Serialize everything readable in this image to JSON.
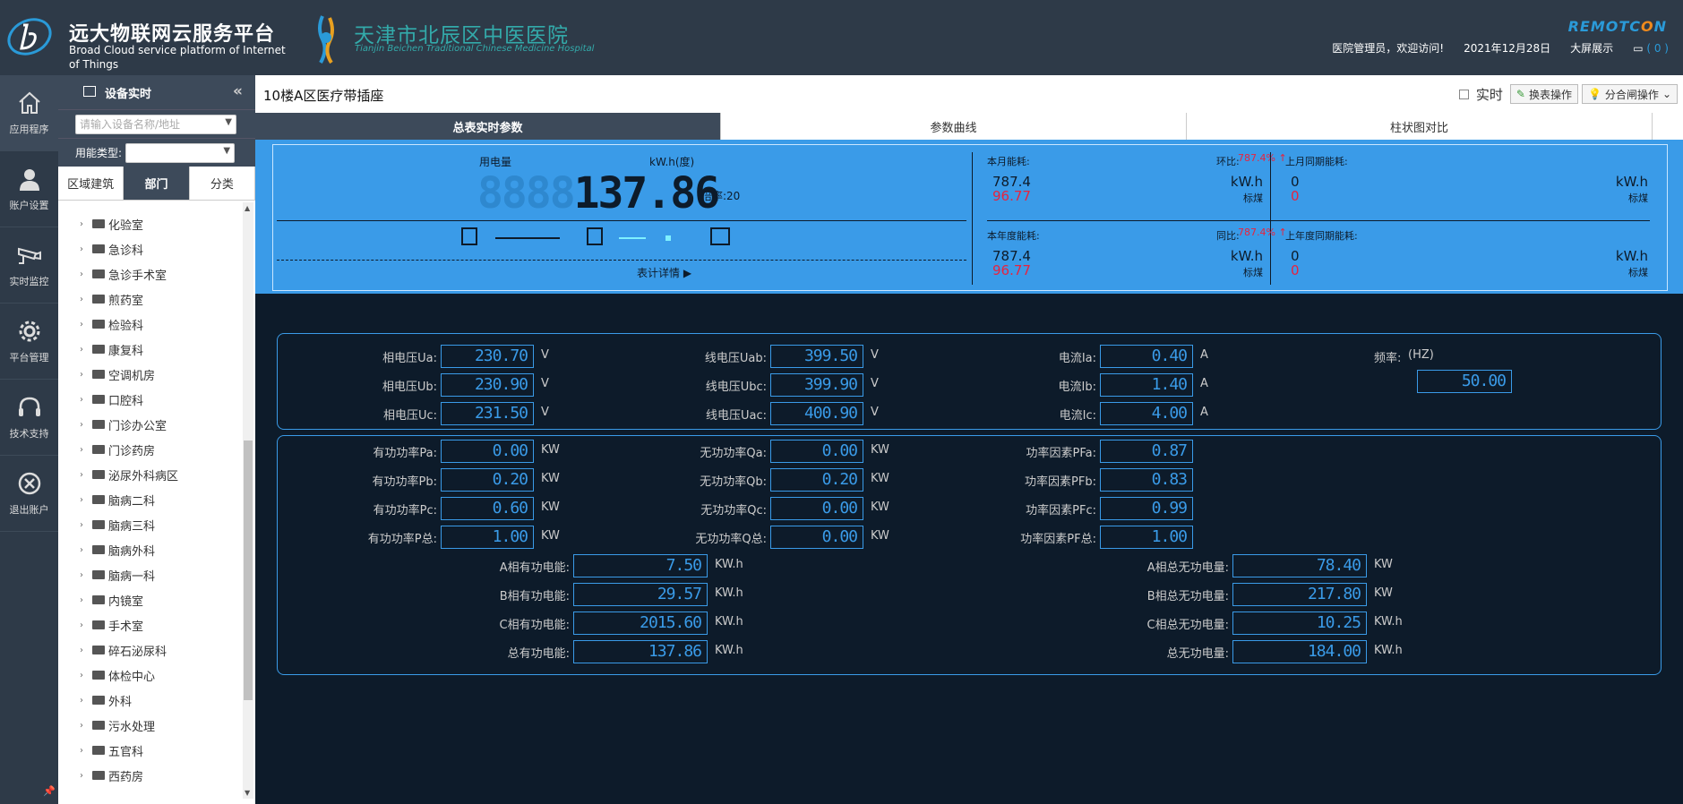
{
  "header": {
    "brand_title": "远大物联网云服务平台",
    "brand_subtitle": "Broad Cloud service platform of Internet of Things",
    "hospital_name": "天津市北辰区中医医院",
    "hospital_en": "Tianjin Beichen Traditional Chinese Medicine Hospital",
    "vendor_logo_prefix": "REMOTC",
    "vendor_logo_mid": "O",
    "vendor_logo_suffix": "N",
    "welcome": "医院管理员，欢迎访问!",
    "date": "2021年12月28日",
    "bigscreen": "大屏展示",
    "msg_count": "( 0 )"
  },
  "leftnav": [
    {
      "label": "应用程序",
      "icon": "home-icon"
    },
    {
      "label": "账户设置",
      "icon": "user-icon"
    },
    {
      "label": "实时监控",
      "icon": "camera-icon"
    },
    {
      "label": "平台管理",
      "icon": "gear-icon"
    },
    {
      "label": "技术支持",
      "icon": "headset-icon"
    },
    {
      "label": "退出账户",
      "icon": "close-circle-icon"
    }
  ],
  "tree": {
    "title": "设备实时",
    "search_placeholder": "请输入设备名称/地址",
    "type_label": "用能类型:",
    "tabs": [
      "区域建筑",
      "部门",
      "分类"
    ],
    "items": [
      "化验室",
      "急诊科",
      "急诊手术室",
      "煎药室",
      "检验科",
      "康复科",
      "空调机房",
      "口腔科",
      "门诊办公室",
      "门诊药房",
      "泌尿外科病区",
      "脑病二科",
      "脑病三科",
      "脑病外科",
      "脑病一科",
      "内镜室",
      "手术室",
      "碎石泌尿科",
      "体检中心",
      "外科",
      "污水处理",
      "五官科",
      "西药房"
    ]
  },
  "main": {
    "title": "10楼A区医疗带插座",
    "realtime_label": "实时",
    "switch_btn": "换表操作",
    "switch_op_btn": "分合闸操作",
    "tabs": [
      "总表实时参数",
      "参数曲线",
      "柱状图对比"
    ]
  },
  "summary": {
    "elec_label": "用电量",
    "elec_unit": "kW.h(度)",
    "lcd_ghost": "8888",
    "lcd_value": "137.86",
    "rate": "倍率:20",
    "detail_link": "表计详情 ▶",
    "month_label": "本月能耗:",
    "month_ratio_label": "环比:",
    "month_ratio": "787.4% ↑",
    "month_kwh": "787.4",
    "month_coal": "96.77",
    "last_month_label": "上月同期能耗:",
    "last_month_kwh": "0",
    "last_month_coal": "0",
    "year_label": "本年度能耗:",
    "year_ratio_label": "同比:",
    "year_ratio": "787.4% ↑",
    "year_kwh": "787.4",
    "year_coal": "96.77",
    "last_year_label": "上年度同期能耗:",
    "last_year_kwh": "0",
    "last_year_coal": "0",
    "kwh_unit": "kW.h",
    "coal_unit": "标煤"
  },
  "params": {
    "voltage": [
      {
        "label": "相电压Ua:",
        "value": "230.70",
        "unit": "V"
      },
      {
        "label": "相电压Ub:",
        "value": "230.90",
        "unit": "V"
      },
      {
        "label": "相电压Uc:",
        "value": "231.50",
        "unit": "V"
      }
    ],
    "line_voltage": [
      {
        "label": "线电压Uab:",
        "value": "399.50",
        "unit": "V"
      },
      {
        "label": "线电压Ubc:",
        "value": "399.90",
        "unit": "V"
      },
      {
        "label": "线电压Uac:",
        "value": "400.90",
        "unit": "V"
      }
    ],
    "current": [
      {
        "label": "电流Ia:",
        "value": "0.40",
        "unit": "A"
      },
      {
        "label": "电流Ib:",
        "value": "1.40",
        "unit": "A"
      },
      {
        "label": "电流Ic:",
        "value": "4.00",
        "unit": "A"
      }
    ],
    "freq_label": "频率:",
    "freq_unit": "(HZ)",
    "freq_value": "50.00",
    "active_power": [
      {
        "label": "有功功率Pa:",
        "value": "0.00",
        "unit": "KW"
      },
      {
        "label": "有功功率Pb:",
        "value": "0.20",
        "unit": "KW"
      },
      {
        "label": "有功功率Pc:",
        "value": "0.60",
        "unit": "KW"
      },
      {
        "label": "有功功率P总:",
        "value": "1.00",
        "unit": "KW"
      }
    ],
    "reactive_power": [
      {
        "label": "无功功率Qa:",
        "value": "0.00",
        "unit": "KW"
      },
      {
        "label": "无功功率Qb:",
        "value": "0.20",
        "unit": "KW"
      },
      {
        "label": "无功功率Qc:",
        "value": "0.00",
        "unit": "KW"
      },
      {
        "label": "无功功率Q总:",
        "value": "0.00",
        "unit": "KW"
      }
    ],
    "power_factor": [
      {
        "label": "功率因素PFa:",
        "value": "0.87"
      },
      {
        "label": "功率因素PFb:",
        "value": "0.83"
      },
      {
        "label": "功率因素PFc:",
        "value": "0.99"
      },
      {
        "label": "功率因素PF总:",
        "value": "1.00"
      }
    ],
    "active_energy": [
      {
        "label": "A相有功电能:",
        "value": "7.50",
        "unit": "KW.h"
      },
      {
        "label": "B相有功电能:",
        "value": "29.57",
        "unit": "KW.h"
      },
      {
        "label": "C相有功电能:",
        "value": "2015.60",
        "unit": "KW.h"
      },
      {
        "label": "总有功电能:",
        "value": "137.86",
        "unit": "KW.h"
      }
    ],
    "reactive_energy": [
      {
        "label": "A相总无功电量:",
        "value": "78.40",
        "unit": "KW"
      },
      {
        "label": "B相总无功电量:",
        "value": "217.80",
        "unit": "KW"
      },
      {
        "label": "C相总无功电量:",
        "value": "10.25",
        "unit": "KW.h"
      },
      {
        "label": "总无功电量:",
        "value": "184.00",
        "unit": "KW.h"
      }
    ]
  }
}
